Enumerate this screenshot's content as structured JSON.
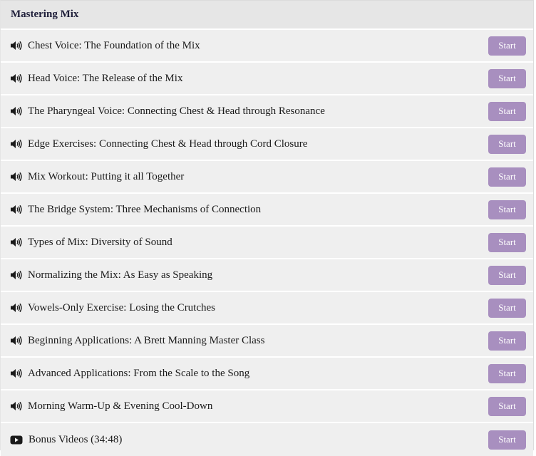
{
  "section": {
    "title": "Mastering Mix"
  },
  "lessons": [
    {
      "icon": "speaker-icon",
      "title": "Chest Voice: The Foundation of the Mix",
      "button": "Start"
    },
    {
      "icon": "speaker-icon",
      "title": "Head Voice: The Release of the Mix",
      "button": "Start"
    },
    {
      "icon": "speaker-icon",
      "title": "The Pharyngeal Voice: Connecting Chest & Head through Resonance",
      "button": "Start"
    },
    {
      "icon": "speaker-icon",
      "title": "Edge Exercises: Connecting Chest & Head through Cord Closure",
      "button": "Start"
    },
    {
      "icon": "speaker-icon",
      "title": "Mix Workout: Putting it all Together",
      "button": "Start"
    },
    {
      "icon": "speaker-icon",
      "title": "The Bridge System: Three Mechanisms of Connection",
      "button": "Start"
    },
    {
      "icon": "speaker-icon",
      "title": "Types of Mix: Diversity of Sound",
      "button": "Start"
    },
    {
      "icon": "speaker-icon",
      "title": "Normalizing the Mix: As Easy as Speaking",
      "button": "Start"
    },
    {
      "icon": "speaker-icon",
      "title": "Vowels-Only Exercise: Losing the Crutches",
      "button": "Start"
    },
    {
      "icon": "speaker-icon",
      "title": "Beginning Applications: A Brett Manning Master Class",
      "button": "Start"
    },
    {
      "icon": "speaker-icon",
      "title": "Advanced Applications: From the Scale to the Song",
      "button": "Start"
    },
    {
      "icon": "speaker-icon",
      "title": "Morning Warm-Up & Evening Cool-Down",
      "button": "Start"
    },
    {
      "icon": "video-play-icon",
      "title": "Bonus Videos (34:48)",
      "button": "Start"
    }
  ],
  "colors": {
    "button_bg": "#a88fbf",
    "header_bg": "#e6e6e6",
    "row_bg": "#efefef",
    "title_text": "#1f1f3a"
  }
}
